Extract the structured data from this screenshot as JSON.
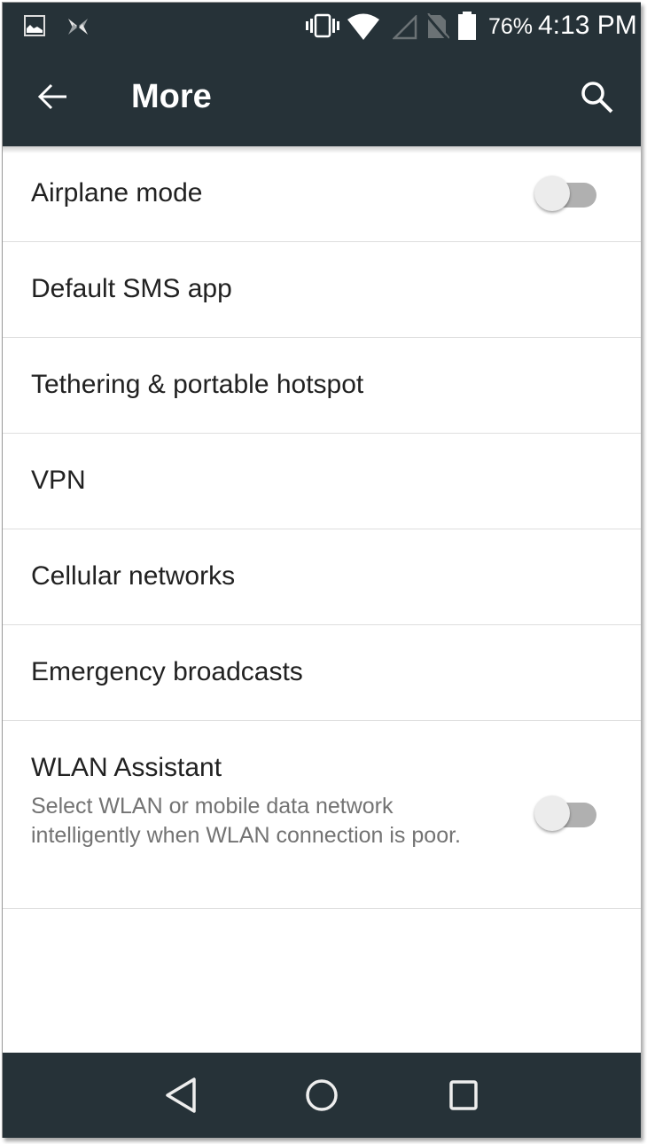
{
  "status_bar": {
    "left_icons": [
      "gallery-notification-icon",
      "app-notification-icon"
    ],
    "right_icons": [
      "vibrate-icon",
      "wifi-icon",
      "no-signal-icon",
      "no-sim-icon",
      "battery-icon"
    ],
    "battery_percent": "76%",
    "time": "4:13 PM"
  },
  "app_bar": {
    "title": "More",
    "back_icon": "arrow-back-icon",
    "search_icon": "search-icon"
  },
  "settings": [
    {
      "label": "Airplane mode",
      "toggle": false
    },
    {
      "label": "Default SMS app"
    },
    {
      "label": "Tethering & portable hotspot"
    },
    {
      "label": "VPN"
    },
    {
      "label": "Cellular networks"
    },
    {
      "label": "Emergency broadcasts"
    },
    {
      "label": "WLAN Assistant",
      "summary": "Select WLAN or mobile data network intelligently when WLAN connection is poor.",
      "toggle": false
    }
  ],
  "nav_bar": {
    "buttons": [
      "back",
      "home",
      "recents"
    ]
  },
  "colors": {
    "bar_background": "#263238",
    "switch_track_off": "#b0b0b0",
    "switch_thumb_off": "#ececec",
    "primary_text": "#212121",
    "secondary_text": "#737373"
  }
}
